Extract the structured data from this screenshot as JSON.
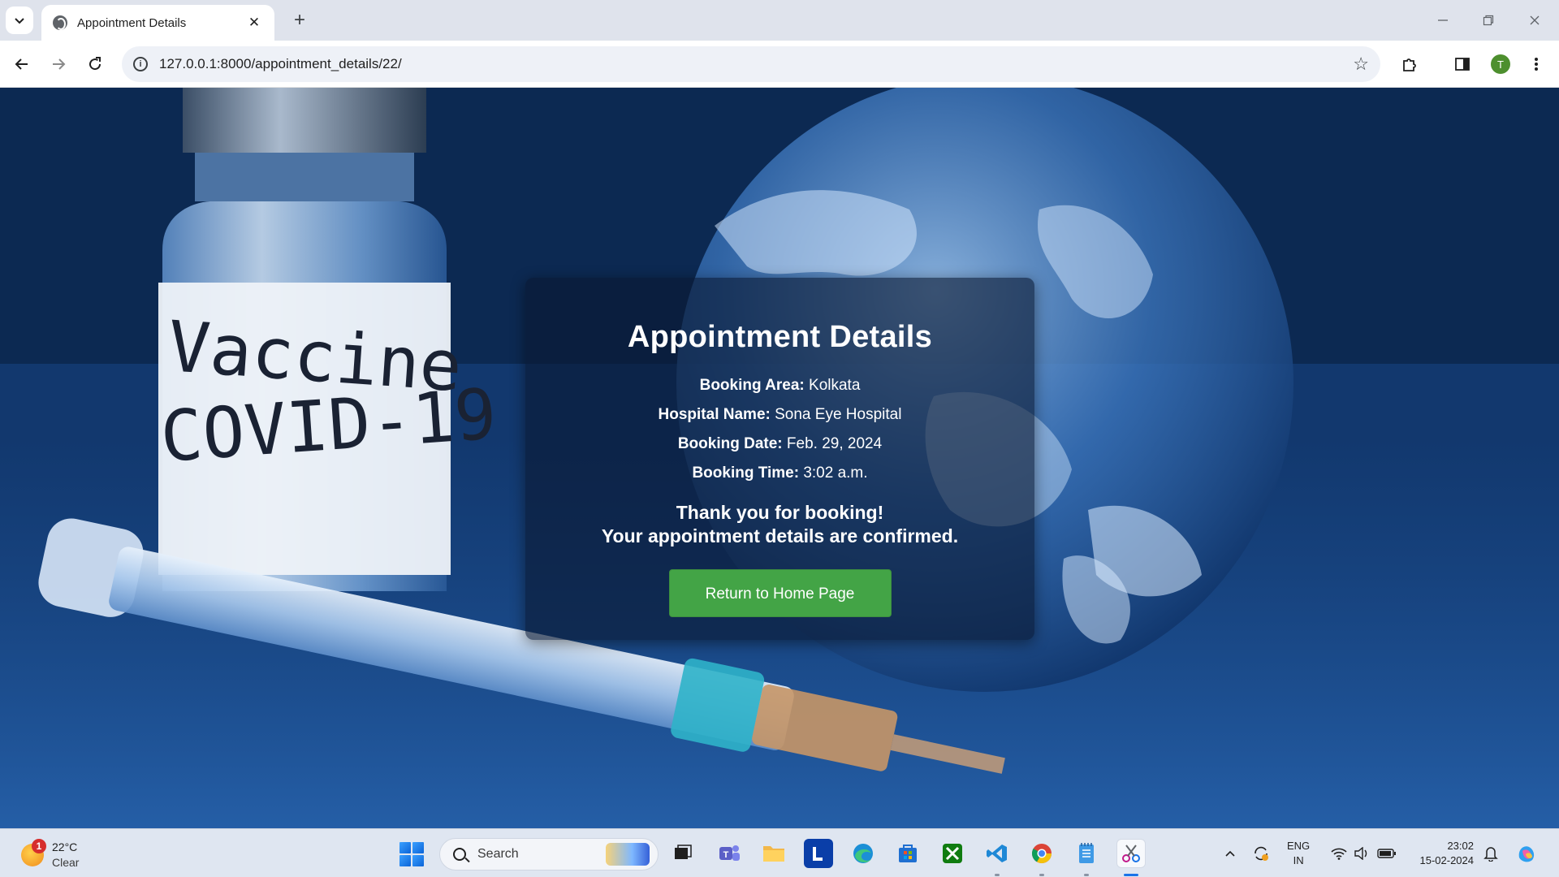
{
  "browser": {
    "tab_title": "Appointment Details",
    "tab_close": "✕",
    "new_tab": "+",
    "url": "127.0.0.1:8000/appointment_details/22/",
    "profile_initial": "T"
  },
  "background": {
    "vial_text_line1": "Vaccine",
    "vial_text_line2": "COVID-19"
  },
  "card": {
    "title": "Appointment Details",
    "details": [
      {
        "label": "Booking Area:",
        "value": "Kolkata"
      },
      {
        "label": "Hospital Name:",
        "value": "Sona Eye Hospital"
      },
      {
        "label": "Booking Date:",
        "value": "Feb. 29, 2024"
      },
      {
        "label": "Booking Time:",
        "value": "3:02 a.m."
      }
    ],
    "thanks_line1": "Thank you for booking!",
    "thanks_line2": "Your appointment details are confirmed.",
    "button_label": "Return to Home Page"
  },
  "taskbar": {
    "weather_badge": "1",
    "temperature": "22°C",
    "condition": "Clear",
    "search_label": "Search",
    "language_line1": "ENG",
    "language_line2": "IN",
    "time": "23:02",
    "date": "15-02-2024",
    "apps": [
      "task-view",
      "teams",
      "file-explorer",
      "l-app",
      "edge",
      "microsoft-store",
      "xbox",
      "vscode",
      "chrome",
      "notepad",
      "snipping-tool"
    ]
  },
  "colors": {
    "button_green": "#43a446",
    "card_bg": "rgba(10,25,50,0.62)",
    "accent_blue": "#1a73e8"
  }
}
